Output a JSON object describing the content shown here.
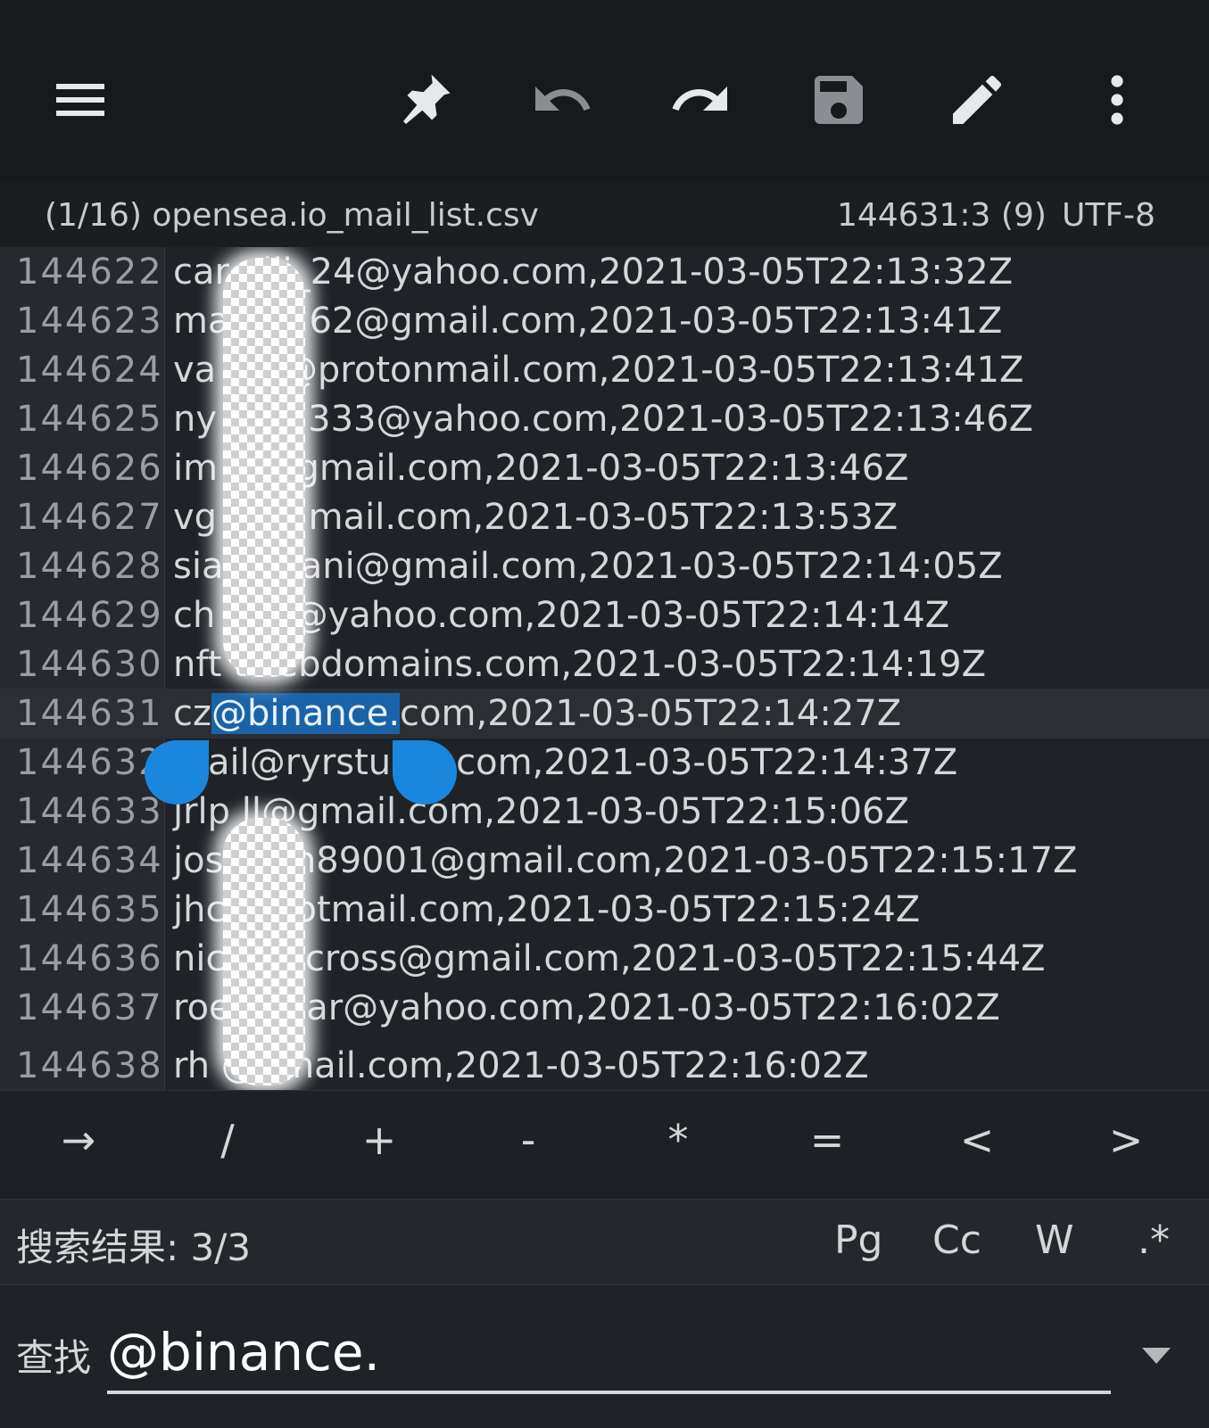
{
  "toolbar": {
    "icons": [
      "menu-icon",
      "pin-icon",
      "undo-icon",
      "redo-icon",
      "save-icon",
      "edit-icon",
      "more-vert-icon"
    ]
  },
  "status": {
    "file": "(1/16) opensea.io_mail_list.csv",
    "position": "144631:3 (9)",
    "encoding": "UTF-8"
  },
  "editor": {
    "lines": [
      {
        "num": "144622",
        "text": "car elli_24@yahoo.com,2021-03-05T22:13:32Z"
      },
      {
        "num": "144623",
        "text": "ma n6262@gmail.com,2021-03-05T22:13:41Z"
      },
      {
        "num": "144624",
        "text": "va ost@protonmail.com,2021-03-05T22:13:41Z"
      },
      {
        "num": "144625",
        "text": "ny fan3333@yahoo.com,2021-03-05T22:13:46Z"
      },
      {
        "num": "144626",
        "text": "im le@gmail.com,2021-03-05T22:13:46Z"
      },
      {
        "num": "144627",
        "text": "vg a@gmail.com,2021-03-05T22:13:53Z"
      },
      {
        "num": "144628",
        "text": "sia davani@gmail.com,2021-03-05T22:14:05Z"
      },
      {
        "num": "144629",
        "text": "ch yan@yahoo.com,2021-03-05T22:14:14Z"
      },
      {
        "num": "144630",
        "text": "nft twebdomains.com,2021-03-05T22:14:19Z"
      },
      {
        "num": "144631",
        "pre": "cz",
        "selected": "@binance.",
        "post": "com,2021-03-05T22:14:27Z"
      },
      {
        "num": "144632",
        "text": "mail@ryrstudio.com,2021-03-05T22:14:37Z"
      },
      {
        "num": "144633",
        "text": "jrlp ll@gmail.com,2021-03-05T22:15:06Z"
      },
      {
        "num": "144634",
        "text": "jos mith89001@gmail.com,2021-03-05T22:15:17Z"
      },
      {
        "num": "144635",
        "text": "jhc @hotmail.com,2021-03-05T22:15:24Z"
      },
      {
        "num": "144636",
        "text": "nic airncross@gmail.com,2021-03-05T22:15:44Z"
      },
      {
        "num": "144637",
        "text": "roe achar@yahoo.com,2021-03-05T22:16:02Z"
      },
      {
        "num": "144638",
        "text": "rh @gmail.com,2021-03-05T22:16:02Z"
      }
    ]
  },
  "symbols": [
    "→",
    "/",
    "+",
    "-",
    "*",
    "=",
    "<",
    ">"
  ],
  "search": {
    "result": "搜索结果: 3/3",
    "options": [
      "Pg",
      "Cc",
      "W",
      ".*"
    ]
  },
  "find": {
    "label": "查找",
    "value": "@binance."
  },
  "colors": {
    "selection": "#1b63a8",
    "handle": "#1a86dd",
    "background": "#1f2328"
  }
}
